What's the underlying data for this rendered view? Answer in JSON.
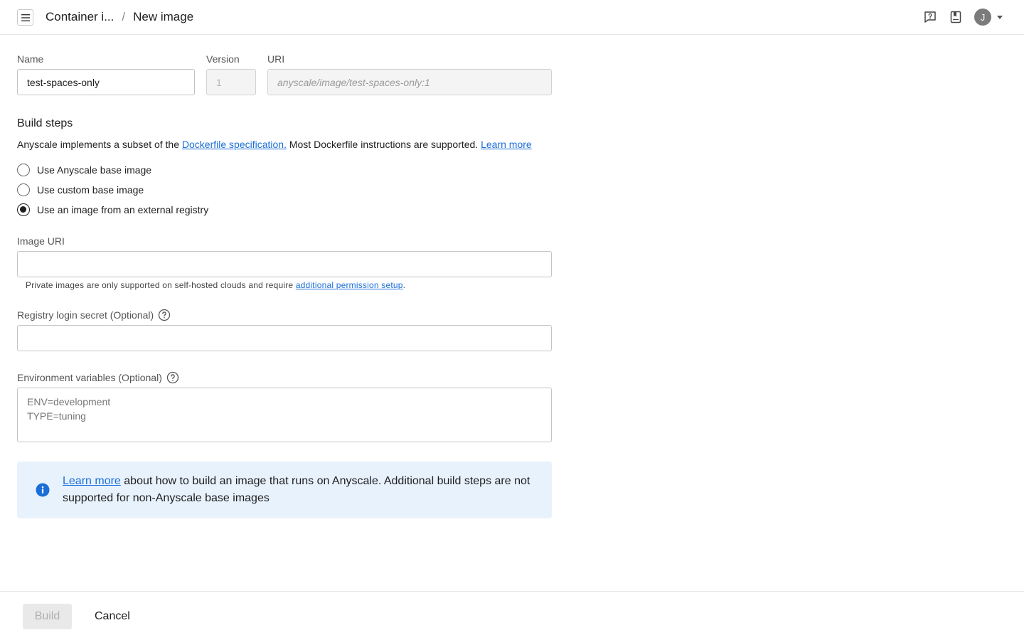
{
  "header": {
    "breadcrumb_parent": "Container i...",
    "breadcrumb_separator": "/",
    "breadcrumb_current": "New image",
    "menu_icon": "hamburger-menu-icon",
    "help_icon": "help-chat-icon",
    "docs_icon": "bookmark-docs-icon",
    "user_initial": "J"
  },
  "form": {
    "name_label": "Name",
    "name_value": "test-spaces-only",
    "version_label": "Version",
    "version_value": "1",
    "uri_label": "URI",
    "uri_value": "anyscale/image/test-spaces-only:1",
    "build_steps_title": "Build steps",
    "desc_before": "Anyscale implements a subset of the ",
    "desc_link": "Dockerfile specification.",
    "desc_middle": " Most Dockerfile instructions are supported. ",
    "desc_learn_more": "Learn more",
    "radio_options": [
      {
        "label": "Use Anyscale base image",
        "checked": false
      },
      {
        "label": "Use custom base image",
        "checked": false
      },
      {
        "label": "Use an image from an external registry",
        "checked": true
      }
    ],
    "image_uri_label": "Image URI",
    "image_uri_value": "",
    "helper_before": "Private images are only supported on self-hosted clouds and require ",
    "helper_link": "additional permission setup",
    "helper_after": ".",
    "secret_label": "Registry login secret (Optional)",
    "secret_value": "",
    "env_label": "Environment variables (Optional)",
    "env_placeholder": "ENV=development\nTYPE=tuning"
  },
  "info": {
    "link": "Learn more",
    "text": " about how to build an image that runs on Anyscale. Additional build steps are not supported for non-Anyscale base images",
    "accent": "#1a6ed8",
    "background": "#e8f2fd"
  },
  "footer": {
    "build_label": "Build",
    "cancel_label": "Cancel"
  }
}
